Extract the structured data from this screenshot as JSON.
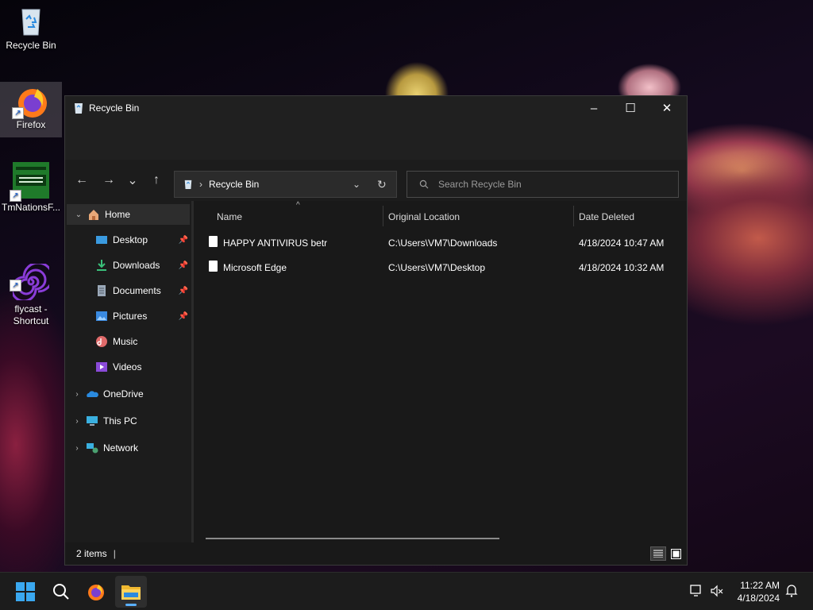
{
  "desktop": {
    "icons": [
      {
        "label": "Recycle Bin"
      },
      {
        "label": "Firefox"
      },
      {
        "label": "TmNationsF..."
      },
      {
        "label": "flycast -\nShortcut"
      }
    ]
  },
  "window": {
    "title": "Recycle Bin",
    "controls": {
      "minimize": "–",
      "maximize": "☐",
      "close": "✕"
    },
    "address": {
      "separator": "›",
      "location": "Recycle Bin"
    },
    "search": {
      "placeholder": "Search Recycle Bin"
    },
    "nav": {
      "back": "←",
      "forward": "→",
      "recent": "⌄",
      "up": "↑",
      "refresh": "↻",
      "dropdown": "⌄"
    },
    "navpane": {
      "home": "Home",
      "quick_access": [
        {
          "label": "Desktop",
          "icon": "desktop-icon",
          "pinned": true
        },
        {
          "label": "Downloads",
          "icon": "downloads-icon",
          "pinned": true
        },
        {
          "label": "Documents",
          "icon": "documents-icon",
          "pinned": true
        },
        {
          "label": "Pictures",
          "icon": "pictures-icon",
          "pinned": true
        },
        {
          "label": "Music",
          "icon": "music-icon",
          "pinned": false
        },
        {
          "label": "Videos",
          "icon": "videos-icon",
          "pinned": false
        }
      ],
      "roots": [
        {
          "label": "OneDrive",
          "icon": "onedrive-icon"
        },
        {
          "label": "This PC",
          "icon": "this-pc-icon"
        },
        {
          "label": "Network",
          "icon": "network-icon"
        }
      ]
    },
    "columns": [
      "Name",
      "Original Location",
      "Date Deleted"
    ],
    "files": [
      {
        "name": "HAPPY ANTIVIRUS betr",
        "location": "C:\\Users\\VM7\\Downloads",
        "date": "4/18/2024 10:47 AM"
      },
      {
        "name": "Microsoft Edge",
        "location": "C:\\Users\\VM7\\Desktop",
        "date": "4/18/2024 10:32 AM"
      }
    ],
    "status": {
      "count": "2 items",
      "separator": "|"
    }
  },
  "taskbar": {
    "clock": {
      "time": "11:22 AM",
      "date": "4/18/2024"
    }
  },
  "colors": {
    "accent": "#0078d4",
    "window_bg": "#191919",
    "taskbar_bg": "#1c1c1c"
  }
}
